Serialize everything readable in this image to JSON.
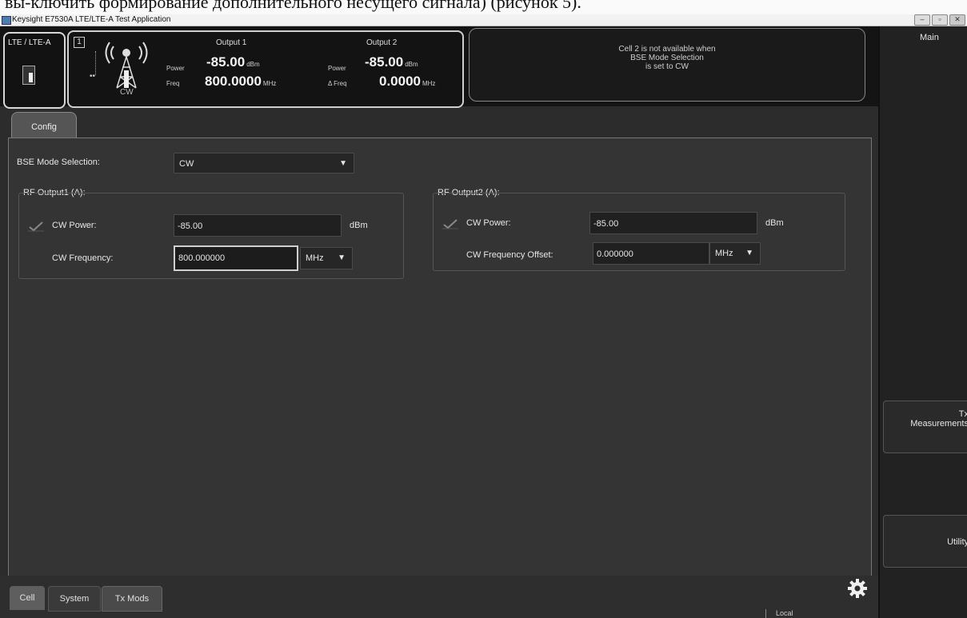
{
  "background_text": "вы-ключить формирование дополнительного несущего сигнала) (рисунок 5).",
  "window": {
    "title": "Keysight E7530A LTE/LTE-A Test Application"
  },
  "header": {
    "tech_label": "LTE / LTE-A",
    "cell_number": "1",
    "tower_mode": "CW",
    "output1": {
      "title": "Output 1",
      "power_label": "Power",
      "power_value": "-85.00",
      "power_unit": "dBm",
      "freq_label": "Freq",
      "freq_value": "800.0000",
      "freq_unit": "MHz"
    },
    "output2": {
      "title": "Output 2",
      "power_label": "Power",
      "power_value": "-85.00",
      "power_unit": "dBm",
      "freq_label": "Δ Freq",
      "freq_value": "0.0000",
      "freq_unit": "MHz"
    },
    "message_lines": [
      "Cell 2 is not available when",
      "BSE Mode Selection",
      "is set to CW"
    ]
  },
  "config_tab": "Config",
  "config": {
    "bse_mode_label": "BSE Mode Selection:",
    "bse_mode_value": "CW",
    "rf1": {
      "title": "RF Output1 (A):",
      "cw_power_label": "CW Power:",
      "cw_power_value": "-85.00",
      "cw_power_unit": "dBm",
      "cw_freq_label": "CW Frequency:",
      "cw_freq_value": "800.000000",
      "cw_freq_unit": "MHz"
    },
    "rf2": {
      "title": "RF Output2 (A):",
      "cw_power_label": "CW Power:",
      "cw_power_value": "-85.00",
      "cw_power_unit": "dBm",
      "cw_freq_offset_label": "CW Frequency Offset:",
      "cw_freq_offset_value": "0.000000",
      "cw_freq_offset_unit": "MHz"
    }
  },
  "bottom_tabs": {
    "cell": "Cell",
    "system": "System",
    "tx_mods": "Tx Mods"
  },
  "status": {
    "local": "Local"
  },
  "sidebar": {
    "title": "Main",
    "tx_measurements_line1": "Tx",
    "tx_measurements_line2": "Measurements",
    "utility": "Utility"
  },
  "colors": {
    "panel_bg": "#343434",
    "header_bg": "#141414",
    "text": "#e6e6e6"
  }
}
